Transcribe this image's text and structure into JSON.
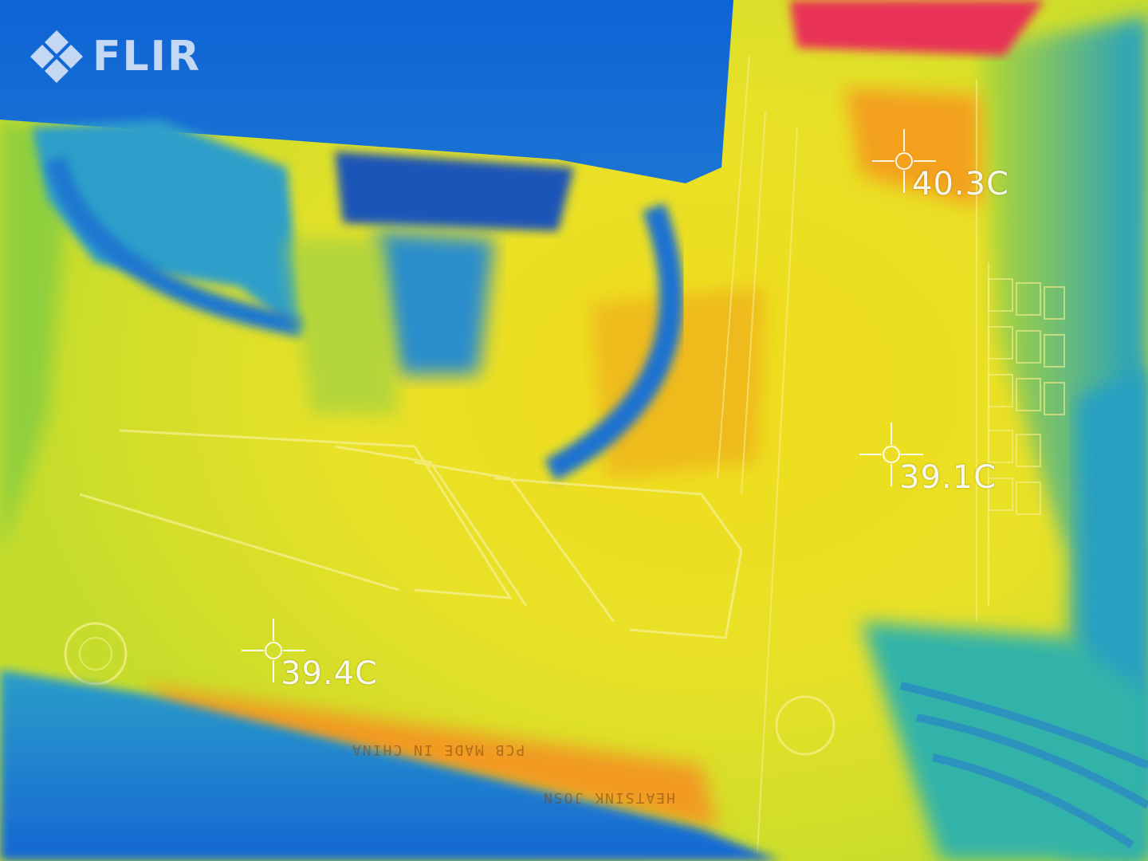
{
  "brand": {
    "logo_text": "FLIR",
    "logo_icon": "flir-diamond-icon"
  },
  "palette": {
    "cold": "#1569d6",
    "cool": "#2fb7a6",
    "mid": "#9fd53a",
    "warm": "#e8e325",
    "hot": "#f5a21b",
    "hottest": "#e8324f"
  },
  "spot_readings": [
    {
      "label": "40.3C"
    },
    {
      "label": "39.1C"
    },
    {
      "label": "39.4C"
    }
  ],
  "pcb_markings": {
    "made_in": "PCB MADE IN CHINA",
    "heatsink": "HEATSINK JOSN"
  }
}
